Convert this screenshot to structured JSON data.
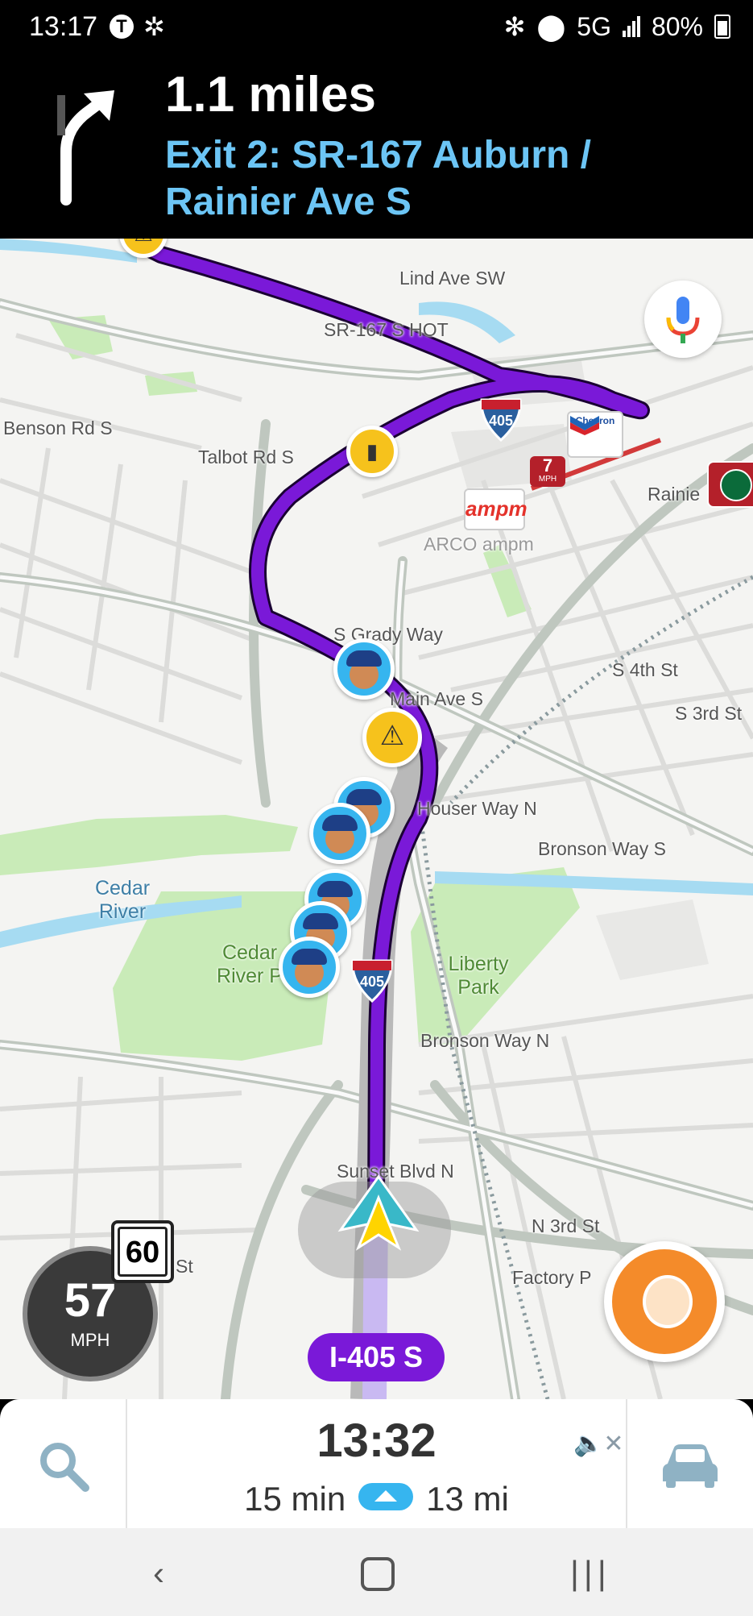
{
  "status_bar": {
    "time": "13:17",
    "carrier_icon": "T",
    "network": "5G",
    "battery": "80%"
  },
  "instruction": {
    "distance": "1.1 miles",
    "exit": "Exit 2: SR-167 Auburn / Rainier Ave S",
    "turn_icon": "turn-right-arrow-icon"
  },
  "map": {
    "street_labels": [
      "Lind Ave SW",
      "SR-167 S HOT",
      "Benson Rd S",
      "Talbot Rd S",
      "Rainie",
      "ARCO ampm",
      "S Grady Way",
      "S 4th St",
      "Main Ave S",
      "S 3rd St",
      "Houser Way N",
      "Bronson Way S",
      "Bronson Way N",
      "Sunset Blvd N",
      "N 3rd St",
      "Factory P",
      "St"
    ],
    "parks": [
      "Cedar River P",
      "Liberty Park"
    ],
    "water": "Cedar River",
    "shields": [
      "405",
      "405"
    ],
    "brands": {
      "chevron": "Chevron",
      "ampm": "ampm"
    },
    "speed_trap": {
      "value": "7",
      "unit": "MPH"
    },
    "current_road": "I-405 S",
    "colors": {
      "route": "#7a19d8",
      "police": "#36b5ef",
      "hazard": "#f6c21c"
    }
  },
  "speed": {
    "limit": "60",
    "current": "57",
    "unit": "MPH"
  },
  "trip": {
    "eta": "13:32",
    "duration": "15 min",
    "distance": "13 mi"
  }
}
